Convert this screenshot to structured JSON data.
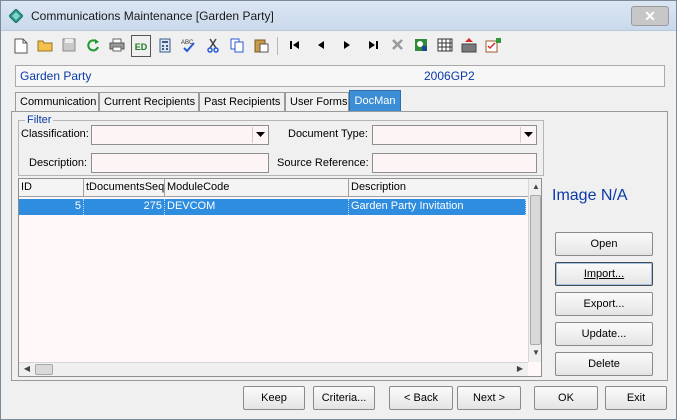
{
  "window": {
    "title": "Communications Maintenance  [Garden Party]",
    "close_label": "✕"
  },
  "toolbar": {
    "icons": [
      "new-document-icon",
      "open-folder-icon",
      "save-disk-icon",
      "refresh-icon",
      "print-icon",
      "edit-icon",
      "calculator-icon",
      "spellcheck-icon",
      "cut-icon",
      "copy-icon",
      "paste-icon",
      "first-record-icon",
      "previous-record-icon",
      "next-record-icon",
      "last-record-icon",
      "delete-x-icon",
      "find-icon",
      "calendar-grid-icon",
      "export-icon",
      "tick-list-icon"
    ],
    "edit_label": "ED"
  },
  "header": {
    "name": "Garden Party",
    "code": "2006GP2"
  },
  "tabs": [
    {
      "label": "Communication"
    },
    {
      "label": "Current Recipients"
    },
    {
      "label": "Past Recipients"
    },
    {
      "label": "User Forms"
    },
    {
      "label": "DocMan",
      "active": true
    }
  ],
  "filter": {
    "legend": "Filter",
    "classification_label": "Classification:",
    "classification_value": "",
    "document_type_label": "Document Type:",
    "document_type_value": "",
    "description_label": "Description:",
    "description_value": "",
    "source_reference_label": "Source Reference:",
    "source_reference_value": ""
  },
  "grid": {
    "columns": [
      "ID",
      "tDocumentsSeq",
      "ModuleCode",
      "Description"
    ],
    "rows": [
      {
        "id": "5",
        "seq": "275",
        "module": "DEVCOM",
        "description": "Garden Party Invitation"
      }
    ]
  },
  "image_placeholder": "Image N/A",
  "side_buttons": {
    "open": "Open",
    "import": "Import...",
    "export": "Export...",
    "update": "Update...",
    "delete": "Delete"
  },
  "bottom_buttons": {
    "keep": "Keep",
    "criteria": "Criteria...",
    "back": "< Back",
    "next": "Next >",
    "ok": "OK",
    "exit": "Exit"
  }
}
